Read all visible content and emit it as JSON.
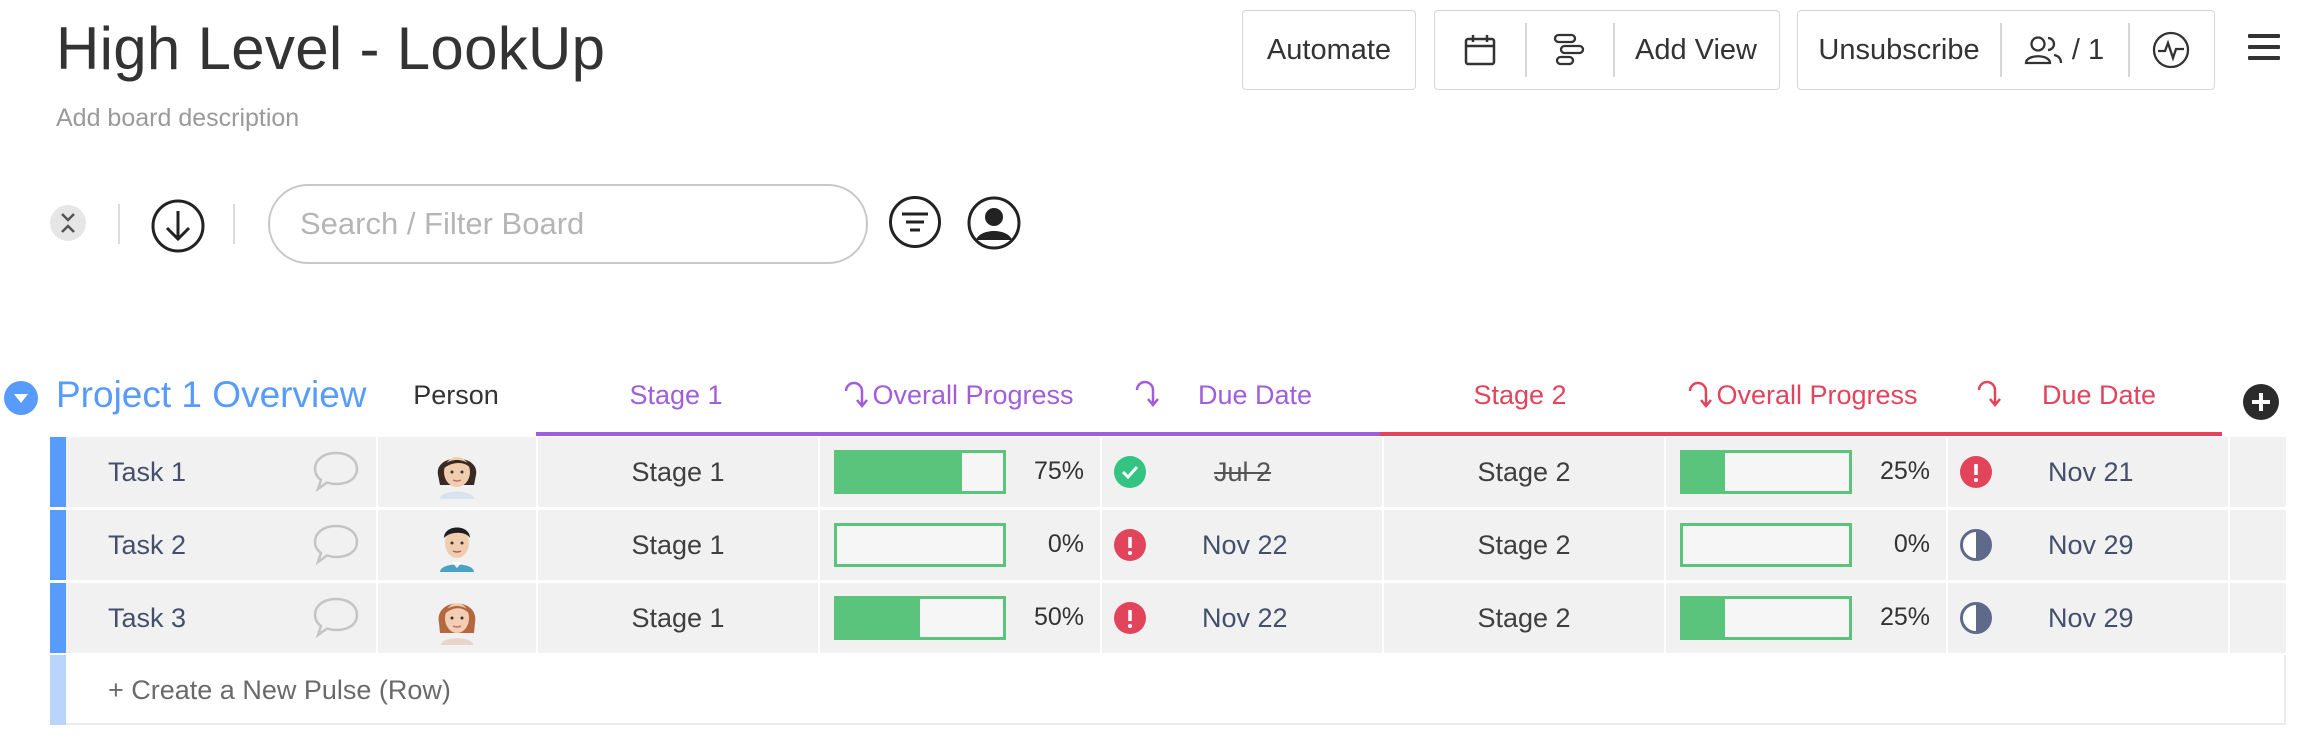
{
  "board": {
    "title": "High Level - LookUp",
    "description": "Add board description"
  },
  "toolbar": {
    "automate_label": "Automate",
    "add_view_label": "Add View",
    "unsubscribe_label": "Unsubscribe",
    "members_count": "/ 1"
  },
  "search": {
    "placeholder": "Search / Filter Board"
  },
  "group": {
    "title": "Project 1 Overview",
    "color": "#579bfc",
    "columns": {
      "person": "Person",
      "stage1": "Stage 1",
      "progress1": "Overall Progress",
      "due1": "Due Date",
      "stage2": "Stage 2",
      "progress2": "Overall Progress",
      "due2": "Due Date"
    },
    "stage1_color": "#a25ddc",
    "stage2_color": "#e2445c",
    "rows": [
      {
        "name": "Task 1",
        "stage1": "Stage 1",
        "progress1": 75,
        "progress1_label": "75%",
        "status1": "done",
        "due1": "Jul 2",
        "stage2": "Stage 2",
        "progress2": 25,
        "progress2_label": "25%",
        "status2": "overdue",
        "due2": "Nov 21"
      },
      {
        "name": "Task 2",
        "stage1": "Stage 1",
        "progress1": 0,
        "progress1_label": "0%",
        "status1": "overdue",
        "due1": "Nov 22",
        "stage2": "Stage 2",
        "progress2": 0,
        "progress2_label": "0%",
        "status2": "half",
        "due2": "Nov 29"
      },
      {
        "name": "Task 3",
        "stage1": "Stage 1",
        "progress1": 50,
        "progress1_label": "50%",
        "status1": "overdue",
        "due1": "Nov 22",
        "stage2": "Stage 2",
        "progress2": 25,
        "progress2_label": "25%",
        "status2": "half",
        "due2": "Nov 29"
      }
    ],
    "create_row_label": "+ Create a New Pulse (Row)"
  },
  "colors": {
    "progress_green": "#5ac47d",
    "done_green": "#33c481",
    "overdue_red": "#e2445c",
    "half_gray": "#5f6a8a"
  }
}
